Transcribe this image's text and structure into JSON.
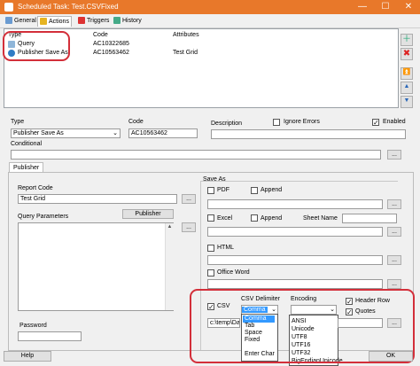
{
  "window": {
    "title": "Scheduled Task: Test.CSVFixed"
  },
  "tabs": [
    {
      "label": "General"
    },
    {
      "label": "Actions"
    },
    {
      "label": "Triggers"
    },
    {
      "label": "History"
    }
  ],
  "actions_table": {
    "headers": [
      "Type",
      "Code",
      "Attributes"
    ],
    "rows": [
      {
        "type": "Query",
        "code": "AC10322685",
        "attributes": ""
      },
      {
        "type": "Publisher Save As",
        "code": "AC10563462",
        "attributes": "Test Grid"
      }
    ]
  },
  "form": {
    "type_label": "Type",
    "type_value": "Publisher Save As",
    "code_label": "Code",
    "code_value": "AC10563462",
    "description_label": "Description",
    "ignore_errors_label": "Ignore Errors",
    "enabled_label": "Enabled",
    "conditional_label": "Conditional",
    "publisher_tab": "Publisher",
    "report_code_label": "Report Code",
    "report_code_value": "Test Grid",
    "query_params_label": "Query Parameters",
    "publisher_button": "Publisher",
    "password_label": "Password",
    "dots": "...",
    "save_as_label": "Save As",
    "pdf_label": "PDF",
    "append_label": "Append",
    "excel_label": "Excel",
    "sheet_name_label": "Sheet Name",
    "html_label": "HTML",
    "word_label": "Office Word",
    "csv_label": "CSV",
    "csv_delimiter_label": "CSV Delimiter",
    "delimiter_value": "Comma",
    "delimiter_options": [
      "Comma",
      "Tab",
      "Space",
      "Fixed",
      "",
      "Enter Char"
    ],
    "encoding_label": "Encoding",
    "encoding_options": [
      "ANSI",
      "Unicode",
      "UTF8",
      "UTF16",
      "UTF32",
      "BigEndianUnicode"
    ],
    "header_row_label": "Header Row",
    "quotes_label": "Quotes",
    "csv_path": "c:\\temp\\Data"
  },
  "footer": {
    "help": "Help",
    "ok": "OK"
  },
  "colors": {
    "title_bar": "#e8782a",
    "selection": "#3399ff",
    "highlight_ring": "#d32f3a"
  }
}
